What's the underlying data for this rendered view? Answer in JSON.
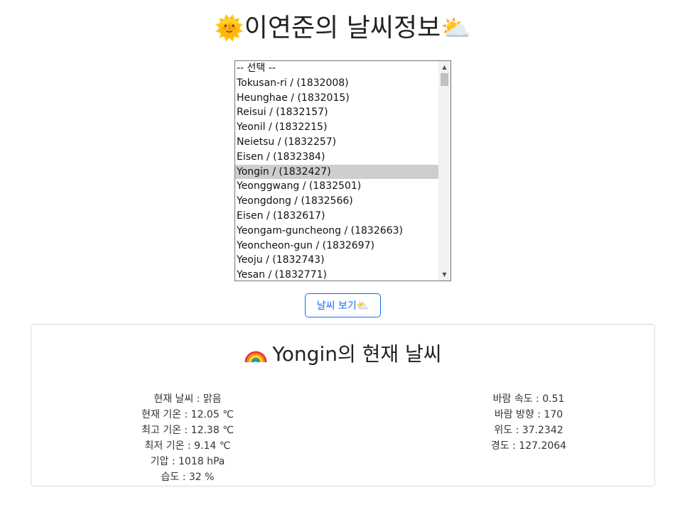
{
  "header": {
    "title": "이연준의 날씨정보",
    "sun_icon": "sun-with-face-icon",
    "cloud_icon": "sun-behind-cloud-icon"
  },
  "city_select": {
    "options": [
      "-- 선택 --",
      "Tokusan-ri / (1832008)",
      "Heunghae / (1832015)",
      "Reisui / (1832157)",
      "Yeonil / (1832215)",
      "Neietsu / (1832257)",
      "Eisen / (1832384)",
      "Yongin / (1832427)",
      "Yeonggwang / (1832501)",
      "Yeongdong / (1832566)",
      "Eisen / (1832617)",
      "Yeongam-guncheong / (1832663)",
      "Yeoncheon-gun / (1832697)",
      "Yeoju / (1832743)",
      "Yesan / (1832771)"
    ],
    "selected": "Yongin / (1832427)"
  },
  "view_button": {
    "label": "날씨 보기",
    "icon": "sun-behind-cloud-icon"
  },
  "weather_card": {
    "title": "Yongin의 현재 날씨",
    "icon": "rainbow-icon",
    "left": [
      "현재 날씨 : 맑음",
      "현재 기온 : 12.05 ℃",
      "최고 기온 : 12.38 ℃",
      "최저 기온 : 9.14 ℃",
      "기압 : 1018 hPa",
      "습도 : 32 %"
    ],
    "right": [
      "바람 속도 : 0.51",
      "바람 방향 : 170",
      "위도 : 37.2342",
      "경도 : 127.2064"
    ]
  },
  "colors": {
    "accent": "#0d6efd",
    "selected_option_bg": "#cecece",
    "card_border": "#d9d9d9"
  }
}
